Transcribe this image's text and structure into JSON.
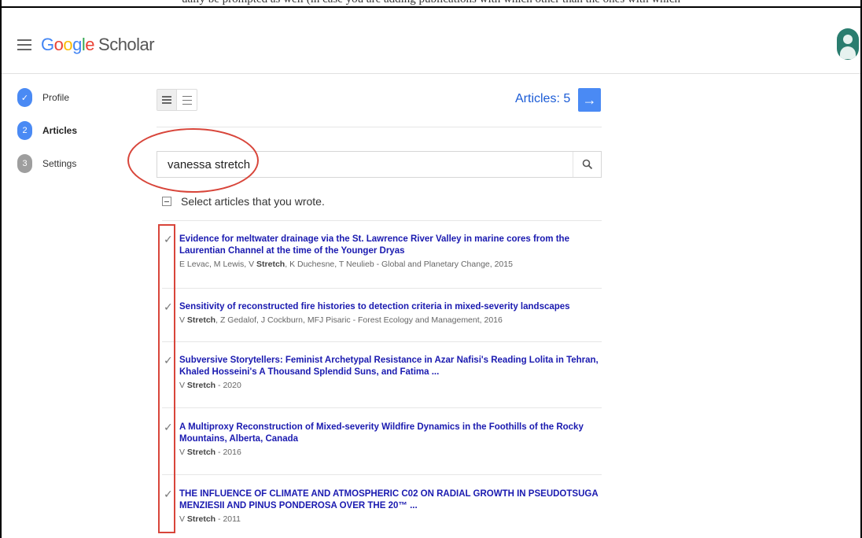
{
  "clipped_top_text": "ually be prompted as well (in case you are adding publications with which other than the ones with which",
  "header": {
    "logo_letters": [
      "G",
      "o",
      "o",
      "g",
      "l",
      "e"
    ],
    "logo_suffix": "Scholar"
  },
  "steps": [
    {
      "number": "✓",
      "label": "Profile",
      "state": "done"
    },
    {
      "number": "2",
      "label": "Articles",
      "state": "active"
    },
    {
      "number": "3",
      "label": "Settings",
      "state": "todo"
    }
  ],
  "toolbar": {
    "articles_count_label": "Articles: 5",
    "next_arrow": "→"
  },
  "search": {
    "value": "vanessa stretch",
    "placeholder": ""
  },
  "selection": {
    "instruction": "Select articles that you wrote."
  },
  "articles": [
    {
      "checked": true,
      "title": "Evidence for meltwater drainage via the St. Lawrence River Valley in marine cores from the Laurentian Channel at the time of the Younger Dryas",
      "authors_before": "E Levac, M Lewis, V ",
      "author_bold": "Stretch",
      "authors_after": ", K Duchesne, T Neulieb - Global and Planetary Change, 2015"
    },
    {
      "checked": true,
      "title": "Sensitivity of reconstructed fire histories to detection criteria in mixed-severity landscapes",
      "authors_before": "V ",
      "author_bold": "Stretch",
      "authors_after": ", Z Gedalof, J Cockburn, MFJ Pisaric - Forest Ecology and Management, 2016"
    },
    {
      "checked": true,
      "title": "Subversive Storytellers: Feminist Archetypal Resistance in Azar Nafisi's Reading Lolita in Tehran, Khaled Hosseini's A Thousand Splendid Suns, and Fatima ...",
      "authors_before": "V ",
      "author_bold": "Stretch",
      "authors_after": " - 2020"
    },
    {
      "checked": true,
      "title": "A Multiproxy Reconstruction of Mixed-severity Wildfire Dynamics in the Foothills of the Rocky Mountains, Alberta, Canada",
      "authors_before": "V ",
      "author_bold": "Stretch",
      "authors_after": " - 2016"
    },
    {
      "checked": true,
      "title": "THE INFLUENCE OF CLIMATE AND ATMOSPHERIC C02 ON RADIAL GROWTH IN PSEUDOTSUGA MENZIESII AND PINUS PONDEROSA OVER THE 20™ ...",
      "authors_before": "V ",
      "author_bold": "Stretch",
      "authors_after": " - 2011"
    }
  ],
  "colors": {
    "accent_blue": "#4a8af4",
    "link_blue": "#1a1ab0",
    "annotation_red": "#d8453a"
  }
}
